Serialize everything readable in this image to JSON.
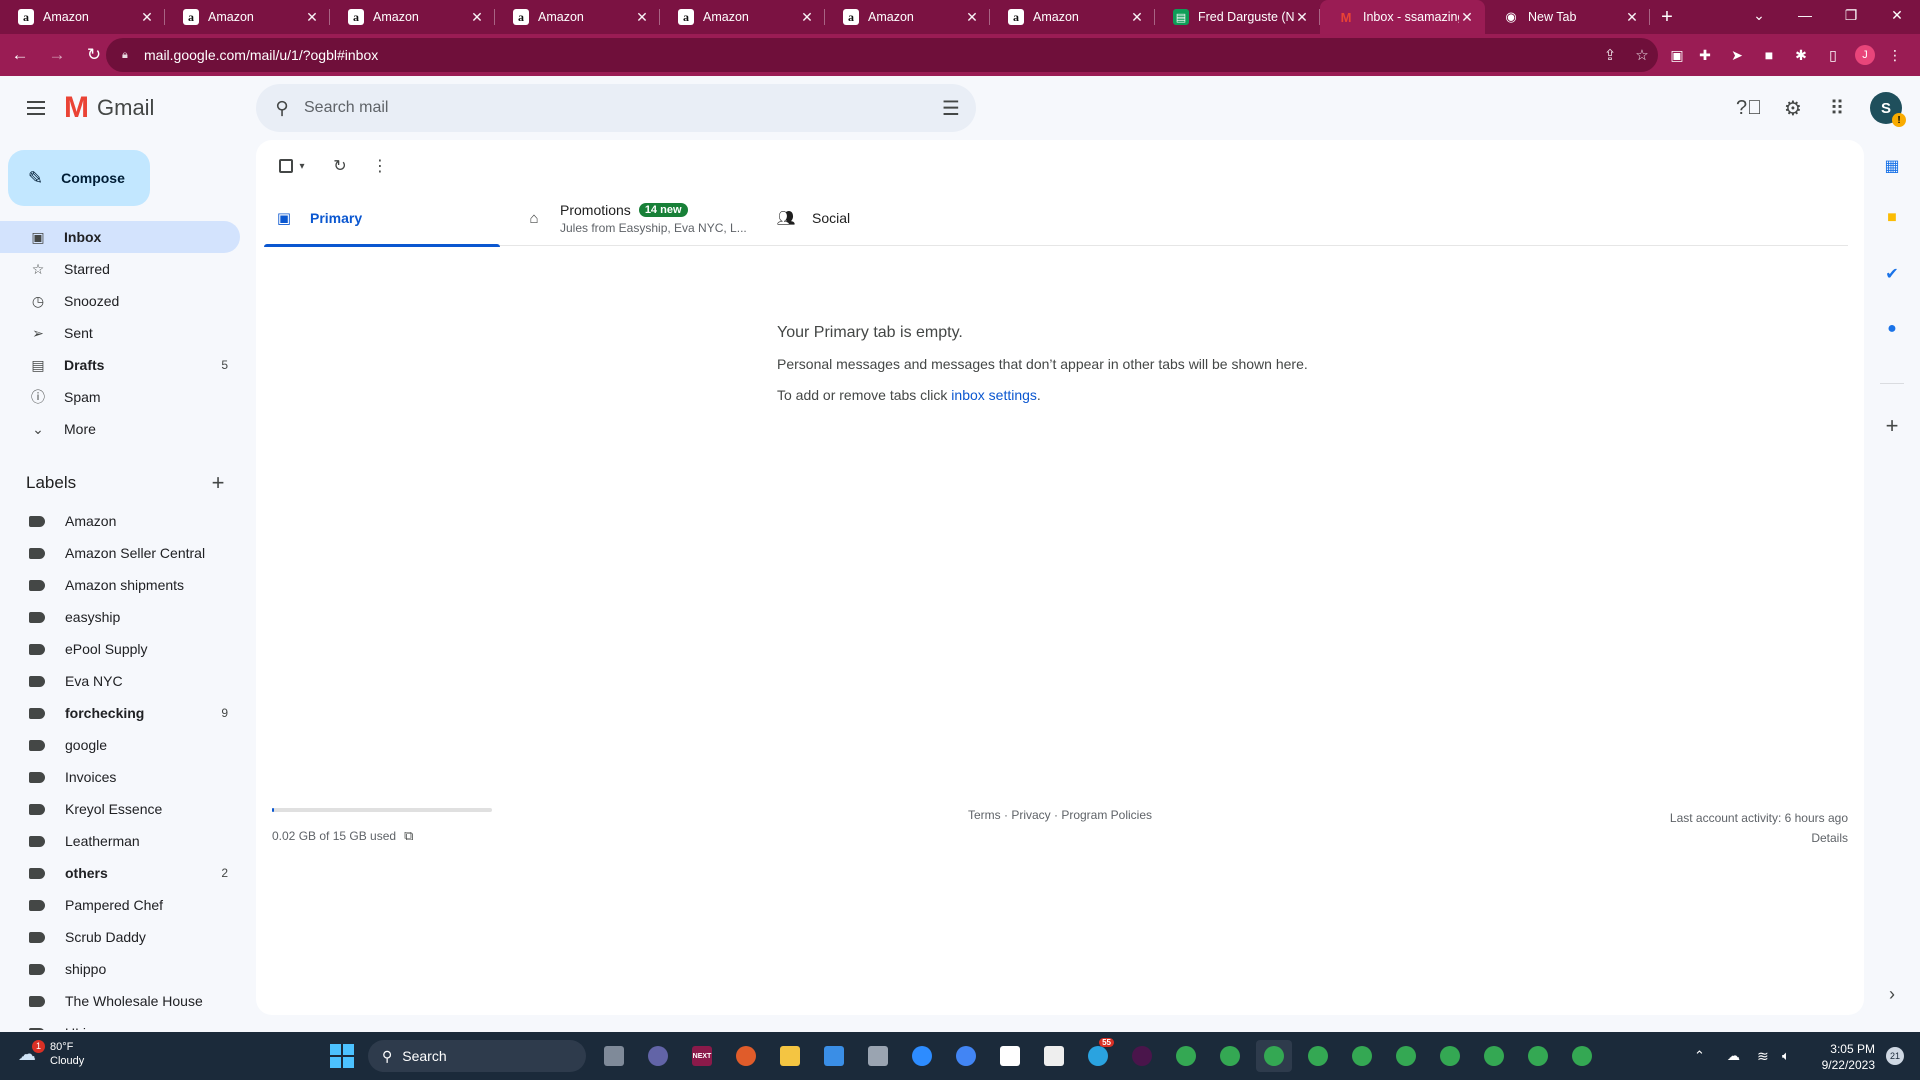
{
  "browser": {
    "tabs": [
      {
        "title": "Amazon",
        "favicon": "amazon-favicon"
      },
      {
        "title": "Amazon",
        "favicon": "amazon-favicon"
      },
      {
        "title": "Amazon",
        "favicon": "amazon-favicon"
      },
      {
        "title": "Amazon",
        "favicon": "amazon-favicon"
      },
      {
        "title": "Amazon",
        "favicon": "amazon-favicon"
      },
      {
        "title": "Amazon",
        "favicon": "amazon-favicon"
      },
      {
        "title": "Amazon",
        "favicon": "amazon-favicon"
      },
      {
        "title": "Fred Darguste (NE",
        "favicon": "google-sheets-favicon"
      },
      {
        "title": "Inbox - ssamazing",
        "favicon": "gmail-favicon",
        "active": true
      },
      {
        "title": "New Tab",
        "favicon": "chrome-favicon"
      }
    ],
    "url": "mail.google.com/mail/u/1/?ogbl#inbox",
    "theme_color": "#7b1242"
  },
  "gmail": {
    "logo_text": "Gmail",
    "search_placeholder": "Search mail",
    "avatar_letter": "S",
    "compose_label": "Compose",
    "nav": [
      {
        "label": "Inbox",
        "icon": "inbox-icon",
        "count": "",
        "active": true,
        "bold": true
      },
      {
        "label": "Starred",
        "icon": "star-icon",
        "count": ""
      },
      {
        "label": "Snoozed",
        "icon": "clock-icon",
        "count": ""
      },
      {
        "label": "Sent",
        "icon": "send-icon",
        "count": ""
      },
      {
        "label": "Drafts",
        "icon": "draft-icon",
        "count": "5",
        "bold": true
      },
      {
        "label": "Spam",
        "icon": "spam-icon",
        "count": ""
      },
      {
        "label": "More",
        "icon": "chevron-down-icon",
        "count": ""
      }
    ],
    "labels_heading": "Labels",
    "labels": [
      {
        "name": "Amazon",
        "count": ""
      },
      {
        "name": "Amazon Seller Central",
        "count": ""
      },
      {
        "name": "Amazon shipments",
        "count": ""
      },
      {
        "name": "easyship",
        "count": ""
      },
      {
        "name": "ePool Supply",
        "count": ""
      },
      {
        "name": "Eva NYC",
        "count": ""
      },
      {
        "name": "forchecking",
        "count": "9",
        "bold": true
      },
      {
        "name": "google",
        "count": ""
      },
      {
        "name": "Invoices",
        "count": ""
      },
      {
        "name": "Kreyol Essence",
        "count": ""
      },
      {
        "name": "Leatherman",
        "count": ""
      },
      {
        "name": "others",
        "count": "2",
        "bold": true
      },
      {
        "name": "Pampered Chef",
        "count": ""
      },
      {
        "name": "Scrub Daddy",
        "count": ""
      },
      {
        "name": "shippo",
        "count": ""
      },
      {
        "name": "The Wholesale House",
        "count": ""
      },
      {
        "name": "ULine",
        "count": ""
      }
    ],
    "inbox_tabs": {
      "primary": "Primary",
      "promotions": "Promotions",
      "promotions_badge": "14 new",
      "promotions_snippet": "Jules from Easyship, Eva NYC, L...",
      "social": "Social"
    },
    "empty_state": {
      "heading": "Your Primary tab is empty.",
      "line1": "Personal messages and messages that don’t appear in other tabs will be shown here.",
      "line2_prefix": "To add or remove tabs click ",
      "line2_link": "inbox settings",
      "line2_suffix": "."
    },
    "footer": {
      "storage_used_fraction": 0.0013,
      "storage_text": "0.02 GB of 15 GB used",
      "policies": "Terms · Privacy · Program Policies",
      "activity": "Last account activity: 6 hours ago",
      "details": "Details"
    }
  },
  "taskbar": {
    "weather_temp": "80°F",
    "weather_desc": "Cloudy",
    "weather_badge": "1",
    "search_label": "Search",
    "time": "3:05 PM",
    "date": "9/22/2023",
    "notification_count": "21"
  }
}
